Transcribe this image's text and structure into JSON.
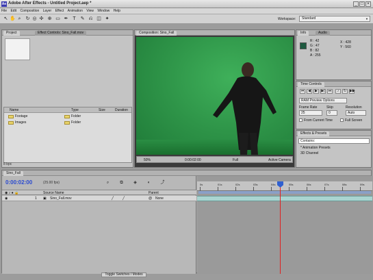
{
  "window": {
    "title": "Adobe After Effects - Untitled Project.aep *",
    "app_icon": "Ae"
  },
  "menubar": {
    "items": [
      "File",
      "Edit",
      "Composition",
      "Layer",
      "Effect",
      "Animation",
      "View",
      "Window",
      "Help"
    ]
  },
  "toolbar": {
    "workspace_label": "Workspace:",
    "workspace_value": "Standard"
  },
  "project_panel": {
    "tabs": [
      "Project",
      "Effect Controls: Sino_Fall.mov"
    ],
    "columns": [
      "Name",
      "Type",
      "Size",
      "Duration"
    ],
    "items": [
      {
        "name": "Footage",
        "type": "Folder"
      },
      {
        "name": "Images",
        "type": "Folder"
      }
    ],
    "footer": "8 bpc"
  },
  "composition_panel": {
    "tab": "Composition: Sino_Fall",
    "footer": {
      "zoom": "50%",
      "timecode": "0:00:02:00",
      "resolution": "Full",
      "camera": "Active Camera"
    }
  },
  "info_panel": {
    "tabs": [
      "Info",
      "Audio"
    ],
    "r": "R : 42",
    "g": "G : 47",
    "b": "B : 82",
    "a": "A : 255",
    "x": "X : 428",
    "y": "Y : 560",
    "swatch_color": "#1f5a40"
  },
  "time_controls": {
    "tab": "Time Controls",
    "ram_preview": "RAM Preview Options",
    "frame_rate_label": "Frame Rate",
    "frame_rate_value": "25",
    "skip_label": "Skip",
    "skip_value": "0",
    "resolution_label": "Resolution",
    "resolution_value": "Auto",
    "from_current": "From Current Time",
    "full_screen": "Full Screen"
  },
  "effects_panel": {
    "tab": "Effects & Presets",
    "search_value": "Contains:",
    "items": [
      "* Animation Presets",
      "3D Channel"
    ]
  },
  "timeline": {
    "tab": "Sino_Fall",
    "timecode": "0:00:02:00",
    "fps": "(25.00 fps)",
    "columns": [
      "Source Name",
      "Parent"
    ],
    "layer": {
      "num": "1",
      "name": "Sino_Fall.mov",
      "parent": "None"
    },
    "ruler_ticks": [
      "0s",
      "01s",
      "02s",
      "03s",
      "04s",
      "05s",
      "06s",
      "07s",
      "08s",
      "09s"
    ],
    "toggle_label": "Toggle Switches / Modes"
  },
  "colors": {
    "greenscreen": "#2e9448",
    "accent": "#3060d0",
    "cti": "#e02020",
    "layer_bar": "#a9d4d0"
  }
}
